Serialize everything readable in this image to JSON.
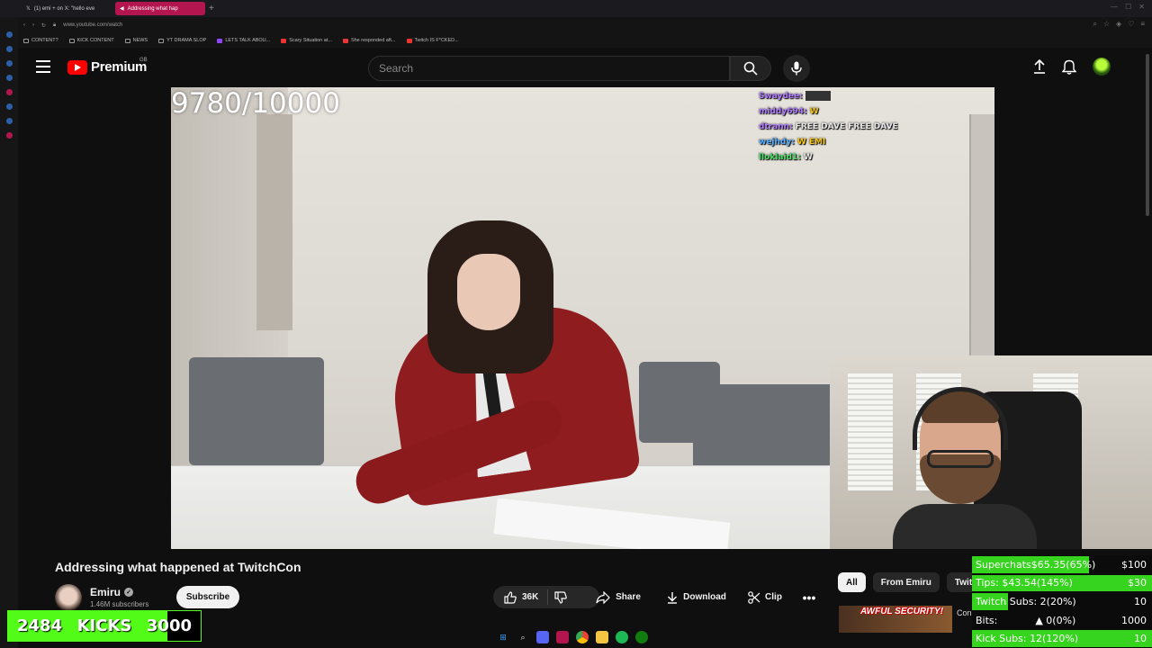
{
  "browser": {
    "tabs": [
      {
        "label": "(1) emi + on X: \"hello eve",
        "active": false
      },
      {
        "label": "Addressing what hap",
        "active": true
      }
    ],
    "url": "www.youtube.com/watch",
    "bookmarks": [
      "CONTENT?",
      "KICK CONTENT",
      "NEWS",
      "YT DRAMA SLOP",
      "LETS TALK ABOU...",
      "Scary Situation at...",
      "She responded aft...",
      "Twitch IS F*CKED..."
    ]
  },
  "header": {
    "logo": "Premium",
    "region": "GB",
    "search_placeholder": "Search"
  },
  "video": {
    "counter": "9780/10000",
    "chat": [
      {
        "user": "Swaydee:",
        "msg": "",
        "color": "#b07cff"
      },
      {
        "user": "middy694:",
        "msg": "W",
        "color": "#b07cff",
        "msg_color": "#f5c518"
      },
      {
        "user": "dtrann:",
        "msg": "FREE DAVE FREE DAVE",
        "color": "#b07cff"
      },
      {
        "user": "wejhdy:",
        "msg": "W EMI",
        "color": "#5ab0ff"
      },
      {
        "user": "lloklaid1:",
        "msg": "W",
        "color": "#4ee06a"
      }
    ],
    "title": "Addressing what happened at TwitchCon"
  },
  "channel": {
    "name": "Emiru",
    "subscribers": "1.46M subscribers",
    "subscribe_label": "Subscribe"
  },
  "actions": {
    "likes": "36K",
    "share": "Share",
    "download": "Download",
    "clip": "Clip",
    "more": "•••"
  },
  "chips": [
    "All",
    "From Emiru",
    "Twitch"
  ],
  "recommendation": {
    "thumb_text": "AWFUL SECURITY!",
    "title": "Con"
  },
  "kicks": {
    "current": "2484",
    "label": "KICKS",
    "goal": "3000",
    "progress": 0.828
  },
  "goals": [
    {
      "label": "Superchats",
      "value": "$65.35(65%)",
      "target": "$100",
      "progress": 0.65
    },
    {
      "label": "Tips:",
      "value": "$43.54(145%)",
      "target": "$30",
      "progress": 1.0
    },
    {
      "label": "Twitch Subs:",
      "value": "2(20%)",
      "target": "10",
      "progress": 0.2
    },
    {
      "label": "Bits:",
      "value": "0(0%)",
      "target": "1000",
      "progress": 0.0
    },
    {
      "label": "Kick Subs:",
      "value": "12(120%)",
      "target": "10",
      "progress": 1.0
    }
  ],
  "colors": {
    "yt_red": "#ff0000",
    "kick_green": "#53fc18",
    "goal_green": "#37d41f",
    "tab_active": "#b3164e"
  }
}
